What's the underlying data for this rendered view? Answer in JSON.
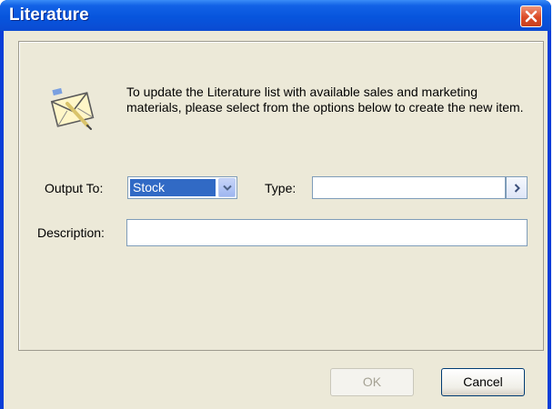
{
  "window": {
    "title": "Literature",
    "close_icon": "close-icon"
  },
  "intro": {
    "icon": "envelope-edit-icon",
    "text": "To update the Literature list with available sales and marketing materials, please select from the options below to create the new item."
  },
  "form": {
    "output_to_label": "Output To:",
    "output_to_value": "Stock",
    "type_label": "Type:",
    "type_value": "",
    "description_label": "Description:",
    "description_value": ""
  },
  "buttons": {
    "ok_label": "OK",
    "ok_enabled": false,
    "cancel_label": "Cancel"
  },
  "colors": {
    "titlebar": "#0755dd",
    "close": "#db4b26",
    "dialog_bg": "#ece9d8",
    "selection": "#316ac5"
  }
}
